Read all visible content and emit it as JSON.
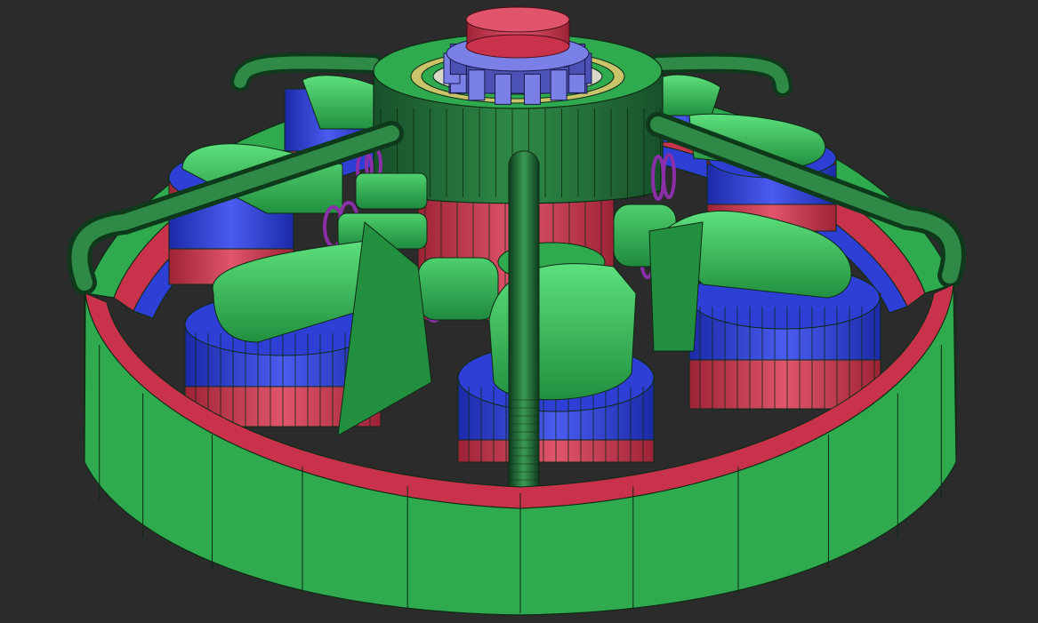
{
  "viewport": {
    "background": "#2b2b2b",
    "render_mode": "shaded-wireframe"
  },
  "model": {
    "subject": "radial assembly",
    "colors": {
      "green": "#2faa4f",
      "green_light": "#3fc25e",
      "green_dark": "#1f6a35",
      "hub_dark": "#1a5a2b",
      "red": "#c8324a",
      "red_light": "#e0556b",
      "blue": "#2e3fd6",
      "blue_light": "#4a5cf0",
      "gear": "#7a80e6",
      "gear_dark": "#4b51b5",
      "purple": "#8a2fa8",
      "yellow": "#c9c46a",
      "wire": "#0d2a14"
    },
    "ring": {
      "segments": 24
    },
    "units": [
      {
        "id": "unit-left-back"
      },
      {
        "id": "unit-left-front"
      },
      {
        "id": "unit-front"
      },
      {
        "id": "unit-right-front"
      },
      {
        "id": "unit-right-back"
      },
      {
        "id": "unit-back"
      }
    ],
    "arms": [
      {
        "id": "arm-left"
      },
      {
        "id": "arm-front"
      },
      {
        "id": "arm-right"
      },
      {
        "id": "arm-back-left"
      },
      {
        "id": "arm-back-right"
      }
    ],
    "gear": {
      "teeth": 14
    }
  }
}
